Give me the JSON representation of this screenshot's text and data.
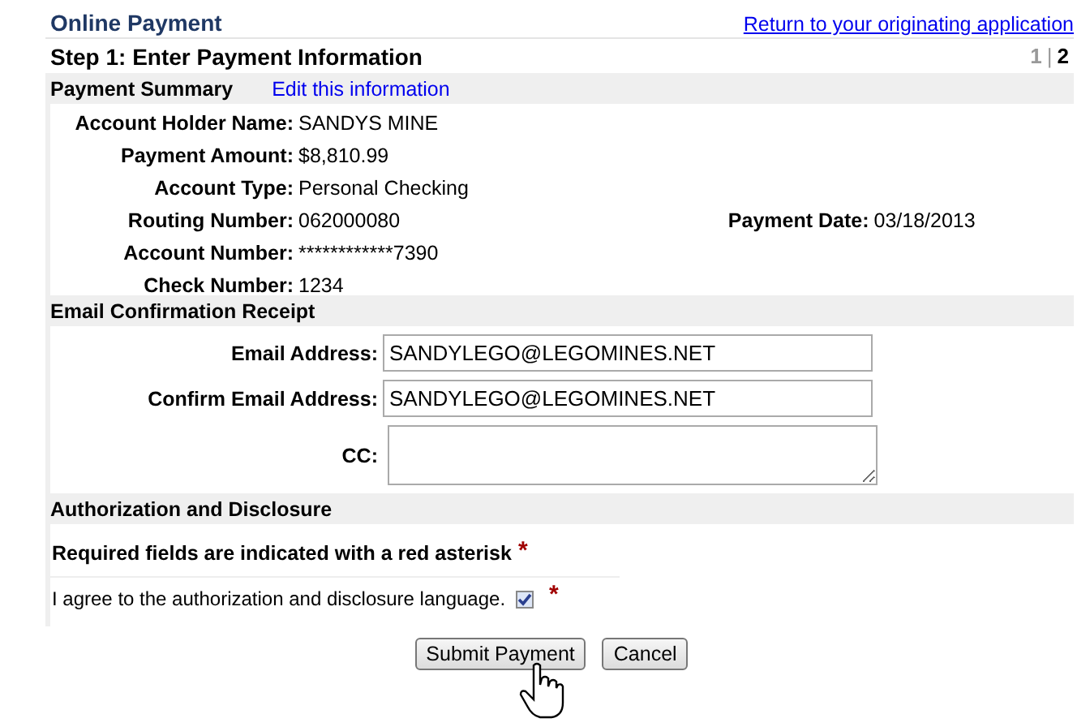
{
  "header": {
    "title": "Online Payment",
    "return_link": "Return to your originating application"
  },
  "step": {
    "title": "Step 1: Enter Payment Information",
    "steps": [
      {
        "label": "1",
        "selected": false
      },
      {
        "label": "2",
        "selected": true
      }
    ],
    "separator": "|"
  },
  "payment_summary": {
    "title": "Payment Summary",
    "edit_link": "Edit this information",
    "fields": [
      {
        "label": "Account Holder Name:",
        "value": "SANDYS MINE"
      },
      {
        "label": "Payment Amount:",
        "value": "$8,810.99"
      },
      {
        "label": "Account Type:",
        "value": "Personal Checking"
      },
      {
        "label": "Routing Number:",
        "value": "062000080"
      },
      {
        "label": "Account Number:",
        "value": "************7390"
      },
      {
        "label": "Check Number:",
        "value": "1234"
      }
    ],
    "side_field": {
      "label": "Payment Date:",
      "value": "03/18/2013"
    }
  },
  "email_receipt": {
    "title": "Email Confirmation Receipt",
    "fields": [
      {
        "kind": "input",
        "label": "Email Address:",
        "value": "SANDYLEGO@LEGOMINES.NET"
      },
      {
        "kind": "input",
        "label": "Confirm Email Address:",
        "value": "SANDYLEGO@LEGOMINES.NET"
      },
      {
        "kind": "textarea",
        "label": "CC:"
      }
    ]
  },
  "authorization": {
    "title": "Authorization and Disclosure",
    "required_note": "Required fields are indicated with a red asterisk",
    "required_mark": "*",
    "agree_label": "I agree to the authorization and disclosure language.",
    "agree_checked": true,
    "agree_mark": "*"
  },
  "buttons": [
    "Submit Payment",
    "Cancel"
  ]
}
